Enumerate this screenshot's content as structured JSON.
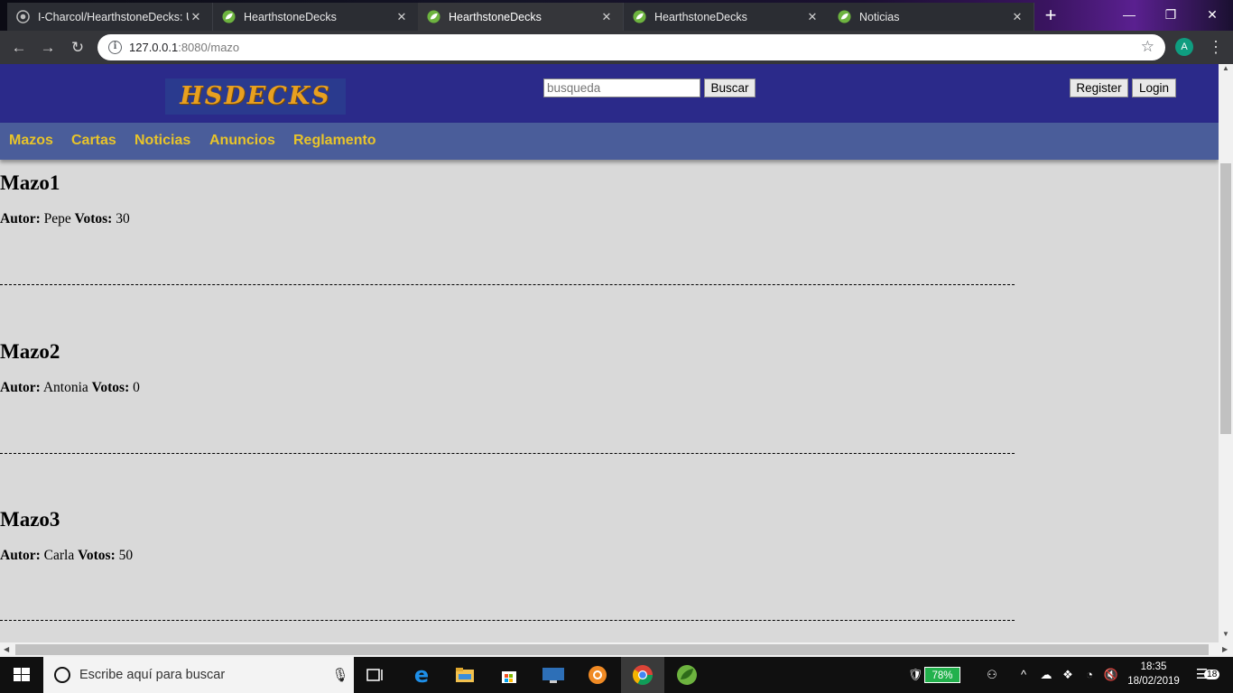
{
  "browser": {
    "tabs": [
      {
        "title": "I-Charcol/HearthstoneDecks: U",
        "favicon": "github-icon",
        "active": false
      },
      {
        "title": "HearthstoneDecks",
        "favicon": "spring-leaf-icon",
        "active": false
      },
      {
        "title": "HearthstoneDecks",
        "favicon": "spring-leaf-icon",
        "active": true
      },
      {
        "title": "HearthstoneDecks",
        "favicon": "spring-leaf-icon",
        "active": false
      },
      {
        "title": "Noticias",
        "favicon": "spring-leaf-icon",
        "active": false
      }
    ],
    "url_host": "127.0.0.1",
    "url_rest": ":8080/mazo",
    "profile_initial": "A"
  },
  "site": {
    "logo_text": "HSDECKS",
    "search_placeholder": "busqueda",
    "search_button": "Buscar",
    "register_button": "Register",
    "login_button": "Login",
    "nav": [
      "Mazos",
      "Cartas",
      "Noticias",
      "Anuncios",
      "Reglamento"
    ],
    "accent_color": "#e8c42a",
    "header_color": "#2b2a8a",
    "nav_color": "#4a5d9a"
  },
  "decks": [
    {
      "name": "Mazo1",
      "author_label": "Autor:",
      "author": "Pepe",
      "votes_label": "Votos:",
      "votes": "30"
    },
    {
      "name": "Mazo2",
      "author_label": "Autor:",
      "author": "Antonia",
      "votes_label": "Votos:",
      "votes": "0"
    },
    {
      "name": "Mazo3",
      "author_label": "Autor:",
      "author": "Carla",
      "votes_label": "Votos:",
      "votes": "50"
    }
  ],
  "taskbar": {
    "search_placeholder": "Escribe aquí para buscar",
    "battery": "78%",
    "time": "18:35",
    "date": "18/02/2019",
    "notifications": "18"
  }
}
